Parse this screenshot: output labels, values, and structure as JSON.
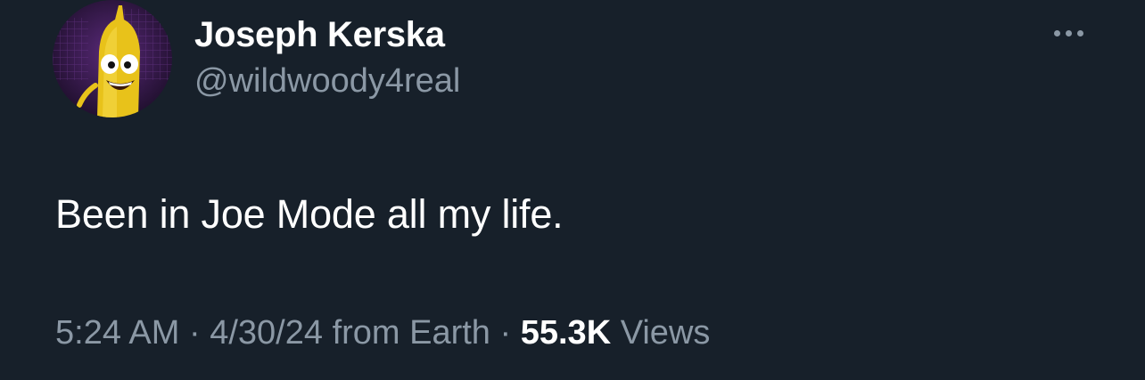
{
  "author": {
    "display_name": "Joseph Kerska",
    "handle": "@wildwoody4real",
    "avatar_icon": "cartoon-mustard-character-avatar"
  },
  "menu": {
    "icon": "more-horizontal-icon"
  },
  "tweet": {
    "text": "Been in Joe Mode all my life."
  },
  "meta": {
    "time": "5:24 AM",
    "separator": "·",
    "date": "4/30/24",
    "source": "from Earth",
    "views_count": "55.3K",
    "views_label": "Views"
  },
  "colors": {
    "background": "#17202a",
    "primary_text": "#ffffff",
    "secondary_text": "#8b98a5"
  }
}
